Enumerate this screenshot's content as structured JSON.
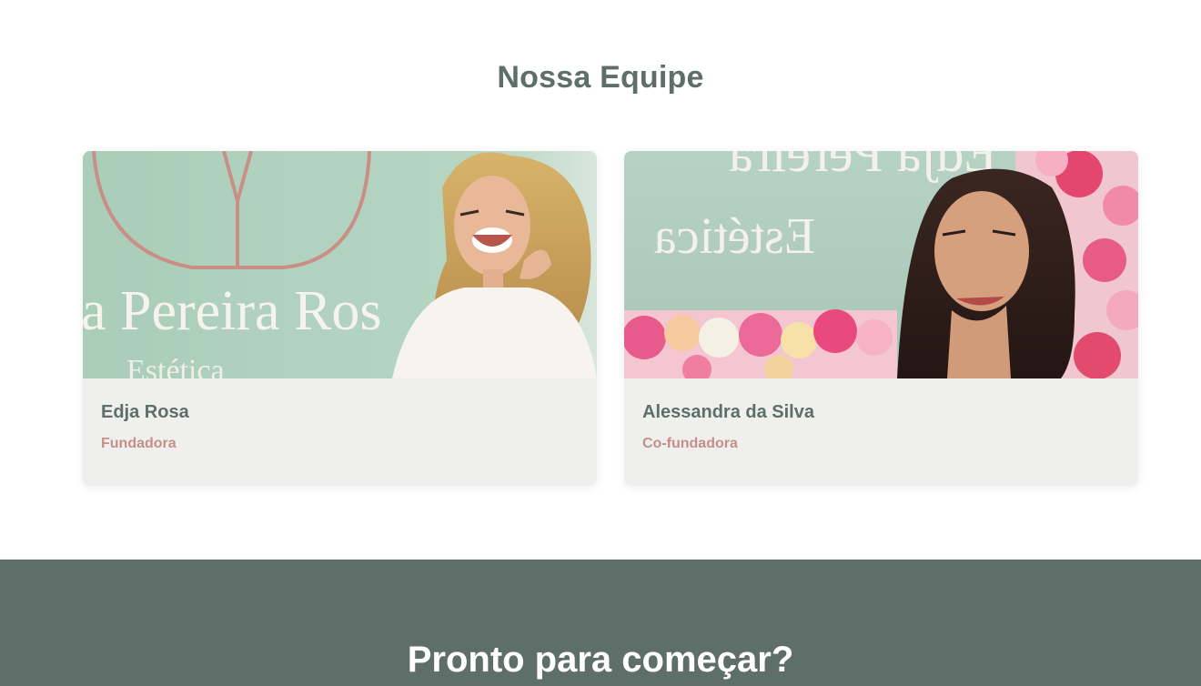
{
  "team": {
    "title": "Nossa Equipe",
    "members": [
      {
        "name": "Edja Rosa",
        "role": "Fundadora",
        "photo_wall_text": "a Pereira Ros",
        "photo_wall_subtext": "Estética"
      },
      {
        "name": "Alessandra da Silva",
        "role": "Co-fundadora",
        "photo_wall_text": "Edja Pereira",
        "photo_wall_subtext": "Estética"
      }
    ]
  },
  "cta": {
    "title": "Pronto para começar?"
  },
  "colors": {
    "heading": "#5e6e68",
    "role_accent": "#c49088",
    "card_bg": "#efefed",
    "cta_bg": "#5e6e68"
  }
}
